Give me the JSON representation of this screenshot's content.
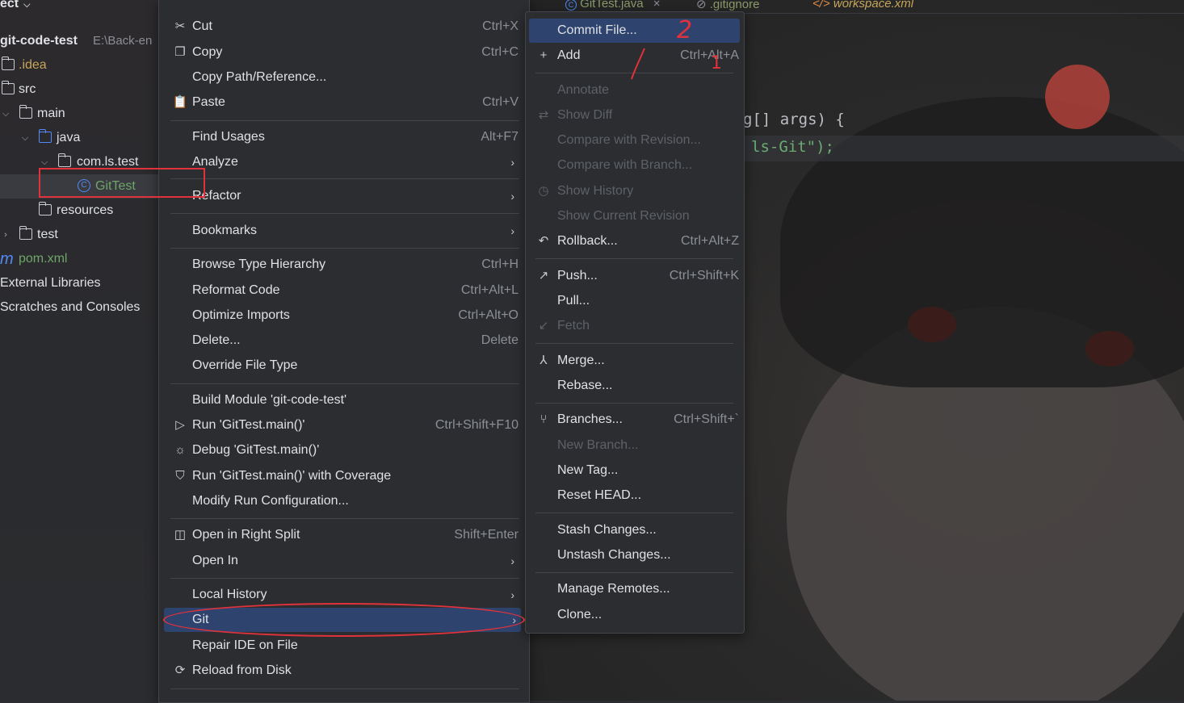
{
  "project": {
    "title": "ect",
    "root": {
      "name": "git-code-test",
      "path": "E:\\Back-en"
    },
    "tree": [
      {
        "label": ".idea",
        "kind": "idea"
      },
      {
        "label": "src",
        "kind": "folder"
      },
      {
        "label": "main",
        "kind": "folder"
      },
      {
        "label": "java",
        "kind": "folder-blue"
      },
      {
        "label": "com.ls.test",
        "kind": "package"
      },
      {
        "label": "GitTest",
        "kind": "class"
      },
      {
        "label": "resources",
        "kind": "folder"
      },
      {
        "label": "test",
        "kind": "folder"
      },
      {
        "label": "pom.xml",
        "kind": "maven"
      },
      {
        "label": "External Libraries",
        "kind": "lib"
      },
      {
        "label": "Scratches and Consoles",
        "kind": "scratch"
      }
    ]
  },
  "editor": {
    "tabs": [
      {
        "label": "GitTest.java",
        "icon": "class-icon"
      },
      {
        "label": ".gitignore",
        "icon": "ignore-icon"
      },
      {
        "label": "workspace.xml",
        "icon": "xml-icon"
      }
    ],
    "code_lines": [
      "g[] args) {",
      "ls-Git\");"
    ]
  },
  "context_menu": {
    "items": [
      {
        "label": "Cut",
        "shortcut": "Ctrl+X",
        "icon": "scissors-icon"
      },
      {
        "label": "Copy",
        "shortcut": "Ctrl+C",
        "icon": "copy-icon"
      },
      {
        "label": "Copy Path/Reference...",
        "shortcut": "",
        "icon": ""
      },
      {
        "label": "Paste",
        "shortcut": "Ctrl+V",
        "icon": "paste-icon"
      },
      {
        "label": "Find Usages",
        "shortcut": "Alt+F7",
        "icon": ""
      },
      {
        "label": "Analyze",
        "shortcut": "",
        "icon": ""
      },
      {
        "label": "Refactor",
        "shortcut": "",
        "icon": ""
      },
      {
        "label": "Bookmarks",
        "shortcut": "",
        "icon": ""
      },
      {
        "label": "Browse Type Hierarchy",
        "shortcut": "Ctrl+H",
        "icon": ""
      },
      {
        "label": "Reformat Code",
        "shortcut": "Ctrl+Alt+L",
        "icon": ""
      },
      {
        "label": "Optimize Imports",
        "shortcut": "Ctrl+Alt+O",
        "icon": ""
      },
      {
        "label": "Delete...",
        "shortcut": "Delete",
        "icon": ""
      },
      {
        "label": "Override File Type",
        "shortcut": "",
        "icon": ""
      },
      {
        "label": "Build Module 'git-code-test'",
        "shortcut": "",
        "icon": ""
      },
      {
        "label": "Run 'GitTest.main()'",
        "shortcut": "Ctrl+Shift+F10",
        "icon": "run-icon"
      },
      {
        "label": "Debug 'GitTest.main()'",
        "shortcut": "",
        "icon": "debug-icon"
      },
      {
        "label": "Run 'GitTest.main()' with Coverage",
        "shortcut": "",
        "icon": "coverage-icon"
      },
      {
        "label": "Modify Run Configuration...",
        "shortcut": "",
        "icon": ""
      },
      {
        "label": "Open in Right Split",
        "shortcut": "Shift+Enter",
        "icon": "split-icon"
      },
      {
        "label": "Open In",
        "shortcut": "",
        "icon": ""
      },
      {
        "label": "Local History",
        "shortcut": "",
        "icon": ""
      },
      {
        "label": "Git",
        "shortcut": "",
        "icon": ""
      },
      {
        "label": "Repair IDE on File",
        "shortcut": "",
        "icon": ""
      },
      {
        "label": "Reload from Disk",
        "shortcut": "",
        "icon": "reload-icon"
      }
    ]
  },
  "git_submenu": {
    "items": [
      {
        "label": "Commit File...",
        "shortcut": ""
      },
      {
        "label": "Add",
        "shortcut": "Ctrl+Alt+A"
      },
      {
        "label": "Annotate",
        "shortcut": ""
      },
      {
        "label": "Show Diff",
        "shortcut": ""
      },
      {
        "label": "Compare with Revision...",
        "shortcut": ""
      },
      {
        "label": "Compare with Branch...",
        "shortcut": ""
      },
      {
        "label": "Show History",
        "shortcut": ""
      },
      {
        "label": "Show Current Revision",
        "shortcut": ""
      },
      {
        "label": "Rollback...",
        "shortcut": "Ctrl+Alt+Z"
      },
      {
        "label": "Push...",
        "shortcut": "Ctrl+Shift+K"
      },
      {
        "label": "Pull...",
        "shortcut": ""
      },
      {
        "label": "Fetch",
        "shortcut": ""
      },
      {
        "label": "Merge...",
        "shortcut": ""
      },
      {
        "label": "Rebase...",
        "shortcut": ""
      },
      {
        "label": "Branches...",
        "shortcut": "Ctrl+Shift+`"
      },
      {
        "label": "New Branch...",
        "shortcut": ""
      },
      {
        "label": "New Tag...",
        "shortcut": ""
      },
      {
        "label": "Reset HEAD...",
        "shortcut": ""
      },
      {
        "label": "Stash Changes...",
        "shortcut": ""
      },
      {
        "label": "Unstash Changes...",
        "shortcut": ""
      },
      {
        "label": "Manage Remotes...",
        "shortcut": ""
      },
      {
        "label": "Clone...",
        "shortcut": ""
      }
    ]
  },
  "annotations": {
    "mark_1": "1",
    "mark_2": "2"
  },
  "colors": {
    "accent": "#2e436e",
    "annotation": "#e0323a",
    "menu_bg": "#2b2d30"
  }
}
